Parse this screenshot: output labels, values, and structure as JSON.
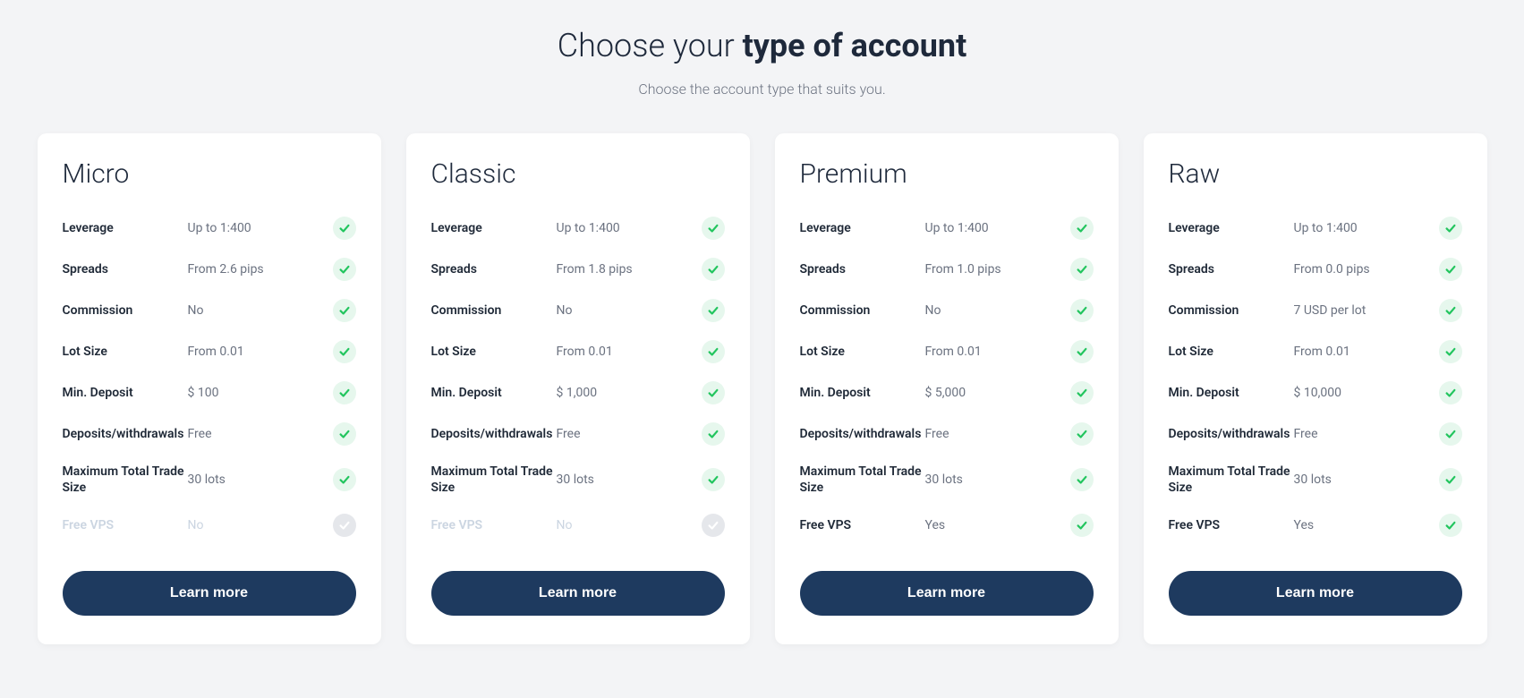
{
  "header": {
    "title_prefix": "Choose your ",
    "title_bold": "type of account",
    "subtitle": "Choose the account type that suits you."
  },
  "feature_labels": {
    "leverage": "Leverage",
    "spreads": "Spreads",
    "commission": "Commission",
    "lot_size": "Lot Size",
    "min_deposit": "Min. Deposit",
    "deposits_withdrawals": "Deposits/withdrawals",
    "max_trade_size": "Maximum Total Trade Size",
    "free_vps": "Free VPS"
  },
  "plans": [
    {
      "name": "Micro",
      "leverage": "Up to 1:400",
      "spreads": "From 2.6 pips",
      "commission": "No",
      "lot_size": "From 0.01",
      "min_deposit": "$ 100",
      "deposits_withdrawals": "Free",
      "max_trade_size": "30 lots",
      "free_vps": "No",
      "free_vps_available": false,
      "cta": "Learn more"
    },
    {
      "name": "Classic",
      "leverage": "Up to 1:400",
      "spreads": "From 1.8 pips",
      "commission": "No",
      "lot_size": "From 0.01",
      "min_deposit": "$ 1,000",
      "deposits_withdrawals": "Free",
      "max_trade_size": "30 lots",
      "free_vps": "No",
      "free_vps_available": false,
      "cta": "Learn more"
    },
    {
      "name": "Premium",
      "leverage": "Up to 1:400",
      "spreads": "From 1.0 pips",
      "commission": "No",
      "lot_size": "From 0.01",
      "min_deposit": "$ 5,000",
      "deposits_withdrawals": "Free",
      "max_trade_size": "30 lots",
      "free_vps": "Yes",
      "free_vps_available": true,
      "cta": "Learn more"
    },
    {
      "name": "Raw",
      "leverage": "Up to 1:400",
      "spreads": "From 0.0 pips",
      "commission": "7 USD per lot",
      "lot_size": "From 0.01",
      "min_deposit": "$ 10,000",
      "deposits_withdrawals": "Free",
      "max_trade_size": "30 lots",
      "free_vps": "Yes",
      "free_vps_available": true,
      "cta": "Learn more"
    }
  ]
}
